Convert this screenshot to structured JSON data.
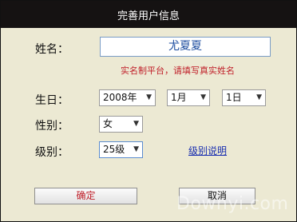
{
  "dialog": {
    "title": "完善用户信息",
    "name_label": "姓名：",
    "name_value": "尤夏夏",
    "name_hint": "实名制平台，请填写真实姓名",
    "birthday_label": "生日：",
    "year": "2008年",
    "month": "1月",
    "day": "1日",
    "gender_label": "性别：",
    "gender": "女",
    "level_label": "级别：",
    "level": "25级",
    "level_help_link": "级别说明",
    "ok_label": "确定",
    "cancel_label": "取消"
  },
  "watermark": "Downyi.com",
  "icons": {
    "dropdown": "chevron-down-icon"
  },
  "colors": {
    "titlebar": "#151212",
    "background": "#ece9d3",
    "hint": "#c0202a",
    "link": "#1a2fb0"
  }
}
